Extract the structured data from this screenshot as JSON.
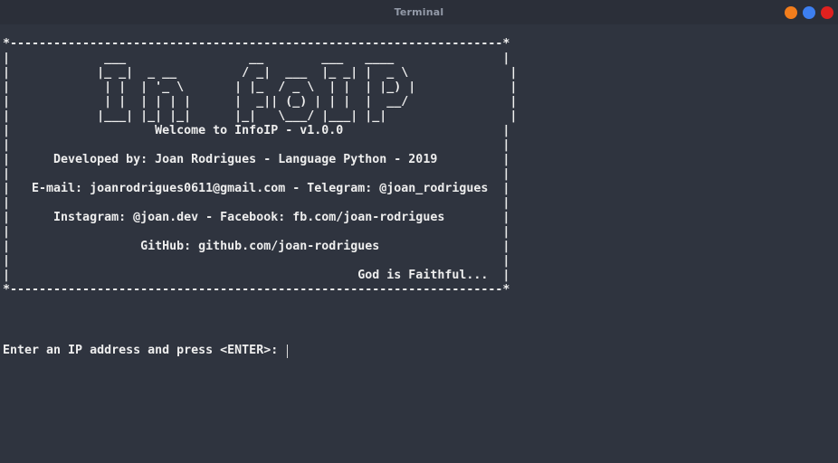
{
  "window": {
    "title": "Terminal",
    "controls": [
      {
        "name": "minimize",
        "color": "#f27d1c"
      },
      {
        "name": "maximize",
        "color": "#3d7ff0"
      },
      {
        "name": "close",
        "color": "#e0211f"
      }
    ]
  },
  "terminal": {
    "lines": [
      "*--------------------------------------------------------------------*",
      "|             ___                 __        ___   ____               |",
      "|            |_ _|  _ __         / _|  ___  |_ _| |  _ \\              |",
      "|             | |  | '_ \\       | |_  / _ \\  | |  | |_) |             |",
      "|             | |  | | | |      |  _|| (_) | | |  |  __/              |",
      "|            |___| |_| |_|      |_|   \\___/ |___| |_|                 |",
      "|                    Welcome to InfoIP - v1.0.0                      |",
      "|                                                                    |",
      "|      Developed by: Joan Rodrigues - Language Python - 2019         |",
      "|                                                                    |",
      "|   E-mail: joanrodrigues0611@gmail.com - Telegram: @joan_rodrigues  |",
      "|                                                                    |",
      "|      Instagram: @joan.dev - Facebook: fb.com/joan-rodrigues        |",
      "|                                                                    |",
      "|                  GitHub: github.com/joan-rodrigues                 |",
      "|                                                                    |",
      "|                                                God is Faithful...  |",
      "*--------------------------------------------------------------------*"
    ],
    "prompt": "Enter an IP address and press <ENTER>: ",
    "input_value": ""
  }
}
